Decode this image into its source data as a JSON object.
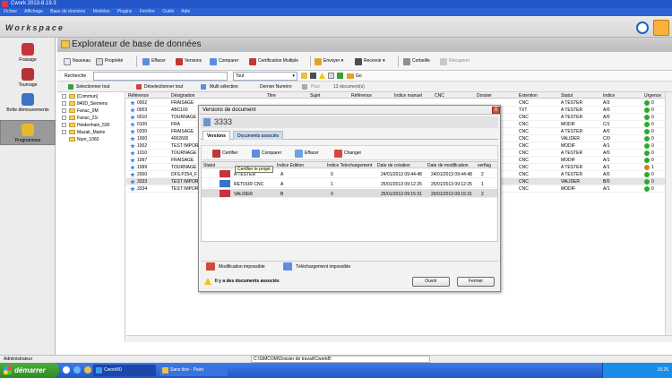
{
  "window": {
    "title": "Cwork 2013-8.19.3"
  },
  "menu": [
    "Fichier",
    "Affichage",
    "Base de données",
    "Modèles",
    "Plugins",
    "Fenêtre",
    "Outils",
    "Aide"
  ],
  "workspace": {
    "title": "Workspace"
  },
  "sidebar": {
    "items": [
      {
        "label": "Fraisage",
        "color": "#c8323c"
      },
      {
        "label": "Tournage",
        "color": "#c8323c"
      },
      {
        "label": "Boîte démouvements",
        "color": "#3a73c8"
      },
      {
        "label": "Programmes",
        "color": "#e7b72c"
      }
    ]
  },
  "main": {
    "title": "Explorateur de base de données",
    "toolbar": {
      "nouveau": "Nouveau",
      "propriete": "Propriété",
      "effacer": "Effacer",
      "versions": "Versions",
      "comparer": "Comparer",
      "certification": "Certification Multiple",
      "envoyer": "Envoyer",
      "recevoir": "Recevoir",
      "corbeille": "Corbeille",
      "recuperer": "Récupérer"
    },
    "search": {
      "label": "Recherche",
      "value": "",
      "filter": "Tout",
      "go": "Go"
    },
    "selection": {
      "select_all": "Selectionner tout",
      "deselect_all": "Déselectionner tout",
      "multi": "Multi sélection",
      "last_number": "Dernier Numéro",
      "plus": "Plus",
      "doc_count": "13 document(s)"
    },
    "tree": [
      "[Commun]",
      "840D_Siemens",
      "Fanuc_0M",
      "Fanuc_21i",
      "Heidenhain_530",
      "Mazak_Matrix",
      "Num_1060"
    ],
    "columns": [
      "Référence",
      "Désignation",
      "Titre",
      "Sujet",
      "Référence",
      "Indice manuel",
      "CNC",
      "Dossier",
      "Extention",
      "Statut",
      "Indice",
      "Urgence"
    ],
    "rows": [
      {
        "ref": "0002",
        "designation": "FRAISAGE",
        "extension": "CNC",
        "status": "A TESTER",
        "index": "A/3",
        "urgency": "0",
        "dot": "#2ea92e"
      },
      {
        "ref": "0003",
        "designation": "ABC100",
        "extension": "TXT",
        "status": "A TESTER",
        "index": "A/0",
        "urgency": "0",
        "dot": "#2ea92e"
      },
      {
        "ref": "0010",
        "designation": "TOURNAGE",
        "extension": "CNC",
        "status": "A TESTER",
        "index": "A/0",
        "urgency": "0",
        "dot": "#2ea92e"
      },
      {
        "ref": "0100",
        "designation": "FRA",
        "extension": "CNC",
        "status": "MODIF",
        "index": "C/1",
        "urgency": "0",
        "dot": "#2ea92e"
      },
      {
        "ref": "0200",
        "designation": "FRAISAGE",
        "extension": "CNC",
        "status": "A TESTER",
        "index": "A/0",
        "urgency": "0",
        "dot": "#2ea92e"
      },
      {
        "ref": "1000",
        "designation": "4002600",
        "extension": "CNC",
        "status": "VALIDER",
        "index": "C/0",
        "urgency": "0",
        "dot": "#2ea92e"
      },
      {
        "ref": "1002",
        "designation": "TEST IMPOR",
        "extension": "CNC",
        "status": "MODIF",
        "index": "A/1",
        "urgency": "0",
        "dot": "#2ea92e"
      },
      {
        "ref": "1010",
        "designation": "TOURNAGE",
        "extension": "CNC",
        "status": "A TESTER",
        "index": "A/0",
        "urgency": "0",
        "dot": "#2ea92e"
      },
      {
        "ref": "1997",
        "designation": "FRAISAGE",
        "extension": "CNC",
        "status": "MODIF",
        "index": "A/1",
        "urgency": "0",
        "dot": "#2ea92e"
      },
      {
        "ref": "1999",
        "designation": "TOURNAGE",
        "extension": "CNC",
        "status": "A TESTER",
        "index": "A/1",
        "urgency": "1",
        "dot": "#e07a1a"
      },
      {
        "ref": "2000",
        "designation": "DFS.P254_F",
        "extension": "CNC",
        "status": "A TESTER",
        "index": "A/0",
        "urgency": "0",
        "dot": "#2ea92e"
      },
      {
        "ref": "3333",
        "designation": "TEST IMPOR",
        "extension": "CNC",
        "status": "VALIDER",
        "index": "B/0",
        "urgency": "0",
        "dot": "#2ea92e"
      },
      {
        "ref": "3334",
        "designation": "TEST IMPOR",
        "extension": "CNC",
        "status": "MODIF",
        "index": "A/1",
        "urgency": "0",
        "dot": "#2ea92e"
      }
    ]
  },
  "dialog": {
    "title": "Versions de document",
    "close": "X",
    "doc_number": "3333",
    "tabs": {
      "versions": "Versions",
      "associated": "Documents associés"
    },
    "tools": {
      "certifier": "Certifier",
      "comparer": "Comparer",
      "effacer": "Effacer",
      "changer": "Changer"
    },
    "tooltip": "Certifier le projet",
    "columns": [
      "Statut",
      "Indice Edition",
      "Indice Telechargement",
      "Date de création",
      "Date de modification",
      "verflag"
    ],
    "rows": [
      {
        "status": "A TESTER",
        "edition": "A",
        "download": "0",
        "created": "24/01/2013 09:44:48",
        "modified": "24/01/2013 09:44:48",
        "verflag": "2"
      },
      {
        "status": "RETOUR CNC",
        "edition": "A",
        "download": "1",
        "created": "25/01/2013 09:12:25",
        "modified": "25/01/2013 09:12:25",
        "verflag": "1"
      },
      {
        "status": "VALIDER",
        "edition": "B",
        "download": "0",
        "created": "25/01/2013 09:15:31",
        "modified": "25/01/2013 09:15:31",
        "verflag": "2"
      }
    ],
    "status": {
      "modif_impossible": "Modification impossible",
      "dl_impossible": "Téléchargement impossible"
    },
    "warning": "Il y a des documents associés",
    "buttons": {
      "open": "Ouvrir",
      "close": "Fermer"
    }
  },
  "statusbar": {
    "user": "Administrateur",
    "path": "C:\\SIMCOM\\Dossier de travail\\Cwork8\\"
  },
  "taskbar": {
    "start": "démarrer",
    "tasks": [
      "Cwork80",
      "Sans titre - Paint"
    ],
    "clock": "16:25"
  }
}
